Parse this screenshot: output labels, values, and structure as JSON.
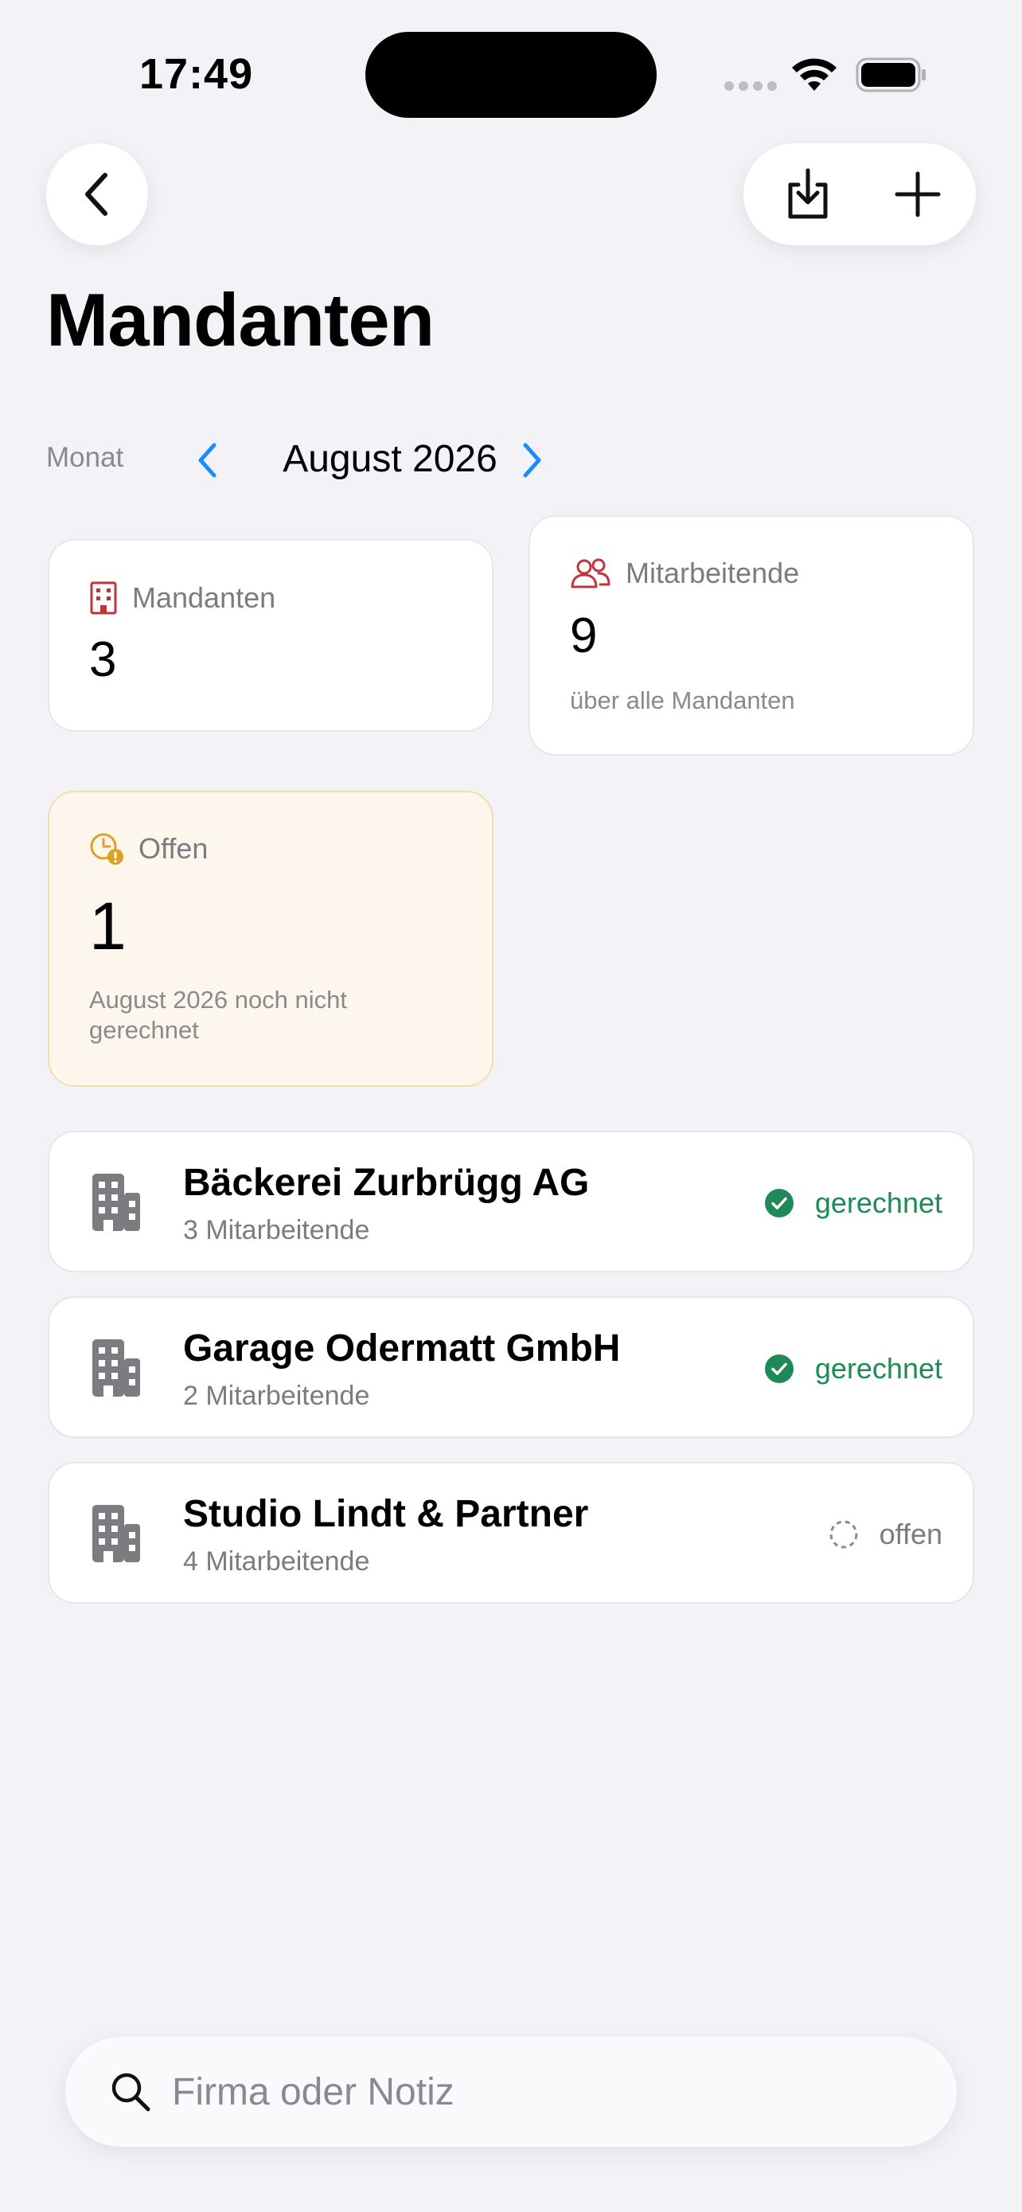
{
  "status_bar": {
    "time": "17:49"
  },
  "nav": {
    "back_icon": "chevron-left-icon",
    "export_icon": "tray-download-icon",
    "add_icon": "plus-icon"
  },
  "page": {
    "title": "Mandanten"
  },
  "month": {
    "label": "Monat",
    "value": "August 2026"
  },
  "stats": {
    "clients": {
      "label": "Mandanten",
      "value": "3",
      "icon": "building-icon",
      "color": "#c0353d"
    },
    "employees": {
      "label": "Mitarbeitende",
      "value": "9",
      "sub": "über alle Mandanten",
      "icon": "people-icon",
      "color": "#c0353d"
    },
    "open": {
      "label": "Offen",
      "value": "1",
      "sub": "August 2026 noch nicht gerechnet",
      "icon": "clock-warning-icon",
      "color": "#e0a024"
    }
  },
  "clients": [
    {
      "name": "Bäckerei Zurbrügg AG",
      "employees": "3 Mitarbeitende",
      "status": "gerechnet",
      "status_type": "done"
    },
    {
      "name": "Garage Odermatt GmbH",
      "employees": "2 Mitarbeitende",
      "status": "gerechnet",
      "status_type": "done"
    },
    {
      "name": "Studio Lindt & Partner",
      "employees": "4 Mitarbeitende",
      "status": "offen",
      "status_type": "open"
    }
  ],
  "search": {
    "placeholder": "Firma oder Notiz",
    "value": ""
  },
  "colors": {
    "accent": "#1a8cff",
    "done": "#1f8a57",
    "background": "#f2f2f7"
  }
}
